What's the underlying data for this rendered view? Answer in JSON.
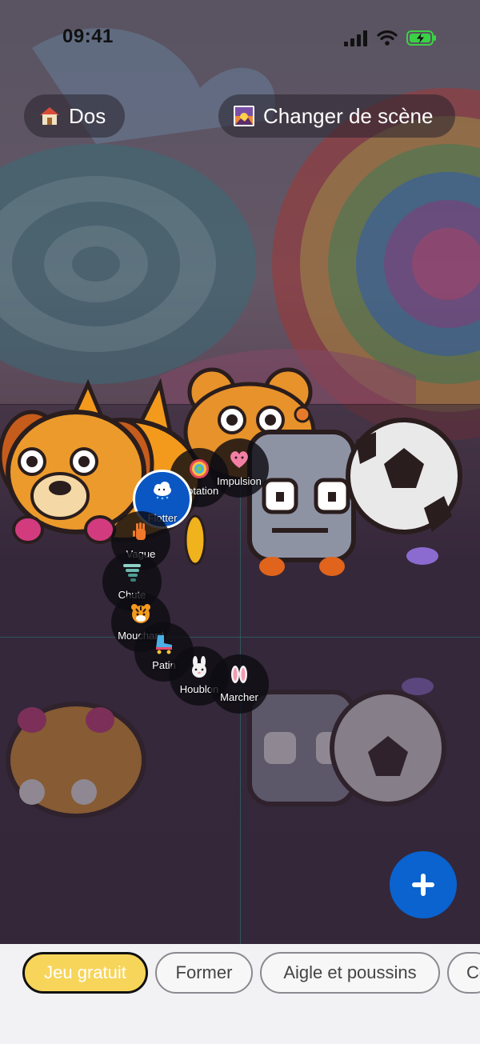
{
  "status_bar": {
    "time": "09:41"
  },
  "header": {
    "back_label": "Dos",
    "back_icon": "house-icon",
    "scene_label": "Changer de scène",
    "scene_icon": "sunset-picture-icon"
  },
  "actions": [
    {
      "label": "Rotation",
      "icon": "lollipop-icon"
    },
    {
      "label": "Impulsion",
      "icon": "heart-face-icon"
    },
    {
      "label": "Flotter",
      "icon": "cloud-icon",
      "active": true
    },
    {
      "label": "Vague",
      "icon": "hand-icon"
    },
    {
      "label": "Chute",
      "icon": "tornado-icon"
    },
    {
      "label": "Mouchard",
      "icon": "tiger-face-icon"
    },
    {
      "label": "Patin",
      "icon": "roller-skate-icon"
    },
    {
      "label": "Houblon",
      "icon": "rabbit-face-icon"
    },
    {
      "label": "Marcher",
      "icon": "bunny-ears-icon"
    }
  ],
  "fab": {
    "icon": "plus-icon"
  },
  "tabs": [
    {
      "label": "Jeu gratuit",
      "selected": true
    },
    {
      "label": "Former"
    },
    {
      "label": "Aigle et poussins"
    },
    {
      "label": "Co"
    }
  ],
  "colors": {
    "accent_blue": "#0a63cf",
    "selected_tab": "#f7d55a",
    "battery_green": "#3bd146"
  }
}
